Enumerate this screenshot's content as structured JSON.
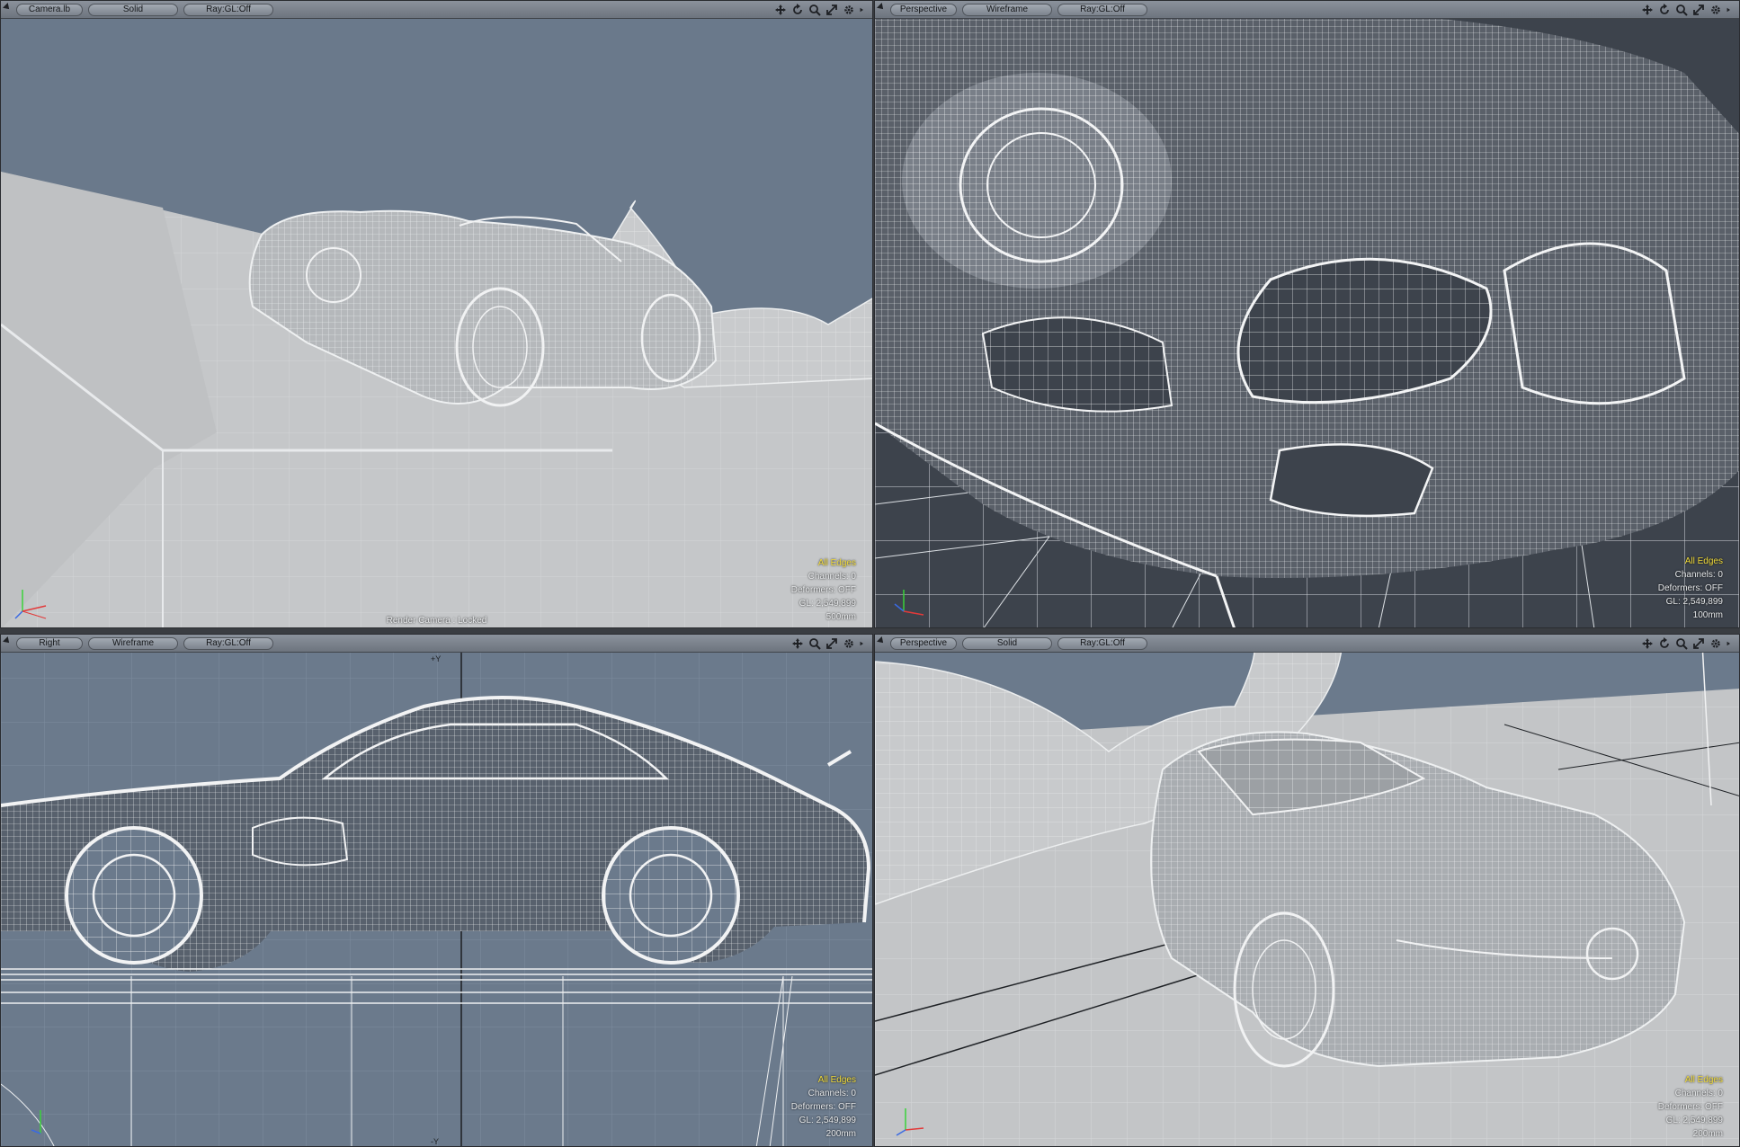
{
  "viewports": [
    {
      "tabs": [
        "Camera.lb",
        "Solid",
        "Ray:GL:Off"
      ],
      "icons": [
        "move-icon",
        "rotate-icon",
        "zoom-icon",
        "maximize-icon",
        "gear-icon",
        "play-arrow-icon"
      ],
      "info": {
        "edges": "All Edges",
        "channels": "Channels: 0",
        "deformers": "Deformers: OFF",
        "gl": "GL: 2,549,899",
        "scale": "500mm"
      },
      "status": "Render Camera : Locked"
    },
    {
      "tabs": [
        "Perspective",
        "Wireframe",
        "Ray:GL:Off"
      ],
      "icons": [
        "move-icon",
        "rotate-icon",
        "zoom-icon",
        "maximize-icon",
        "gear-icon",
        "play-arrow-icon"
      ],
      "info": {
        "edges": "All Edges",
        "channels": "Channels: 0",
        "deformers": "Deformers: OFF",
        "gl": "GL: 2,549,899",
        "scale": "100mm"
      }
    },
    {
      "tabs": [
        "Right",
        "Wireframe",
        "Ray:GL:Off"
      ],
      "icons": [
        "move-icon",
        "zoom-icon",
        "maximize-icon",
        "gear-icon",
        "play-arrow-icon"
      ],
      "info": {
        "edges": "All Edges",
        "channels": "Channels: 0",
        "deformers": "Deformers: OFF",
        "gl": "GL: 2,549,899",
        "scale": "200mm"
      },
      "axis_marks": [
        "+Y",
        "-Y"
      ]
    },
    {
      "tabs": [
        "Perspective",
        "Solid",
        "Ray:GL:Off"
      ],
      "icons": [
        "move-icon",
        "rotate-icon",
        "zoom-icon",
        "maximize-icon",
        "gear-icon",
        "play-arrow-icon"
      ],
      "info": {
        "edges": "All Edges",
        "channels": "Channels: 0",
        "deformers": "Deformers: OFF",
        "gl": "GL: 2,549,899",
        "scale": "200mm"
      }
    }
  ],
  "colors": {
    "viewport_bg": "#6b7a8c",
    "wire": "#e4e6e8",
    "highlight": "#f2dc3a",
    "dark_bg": "#3c424b"
  }
}
